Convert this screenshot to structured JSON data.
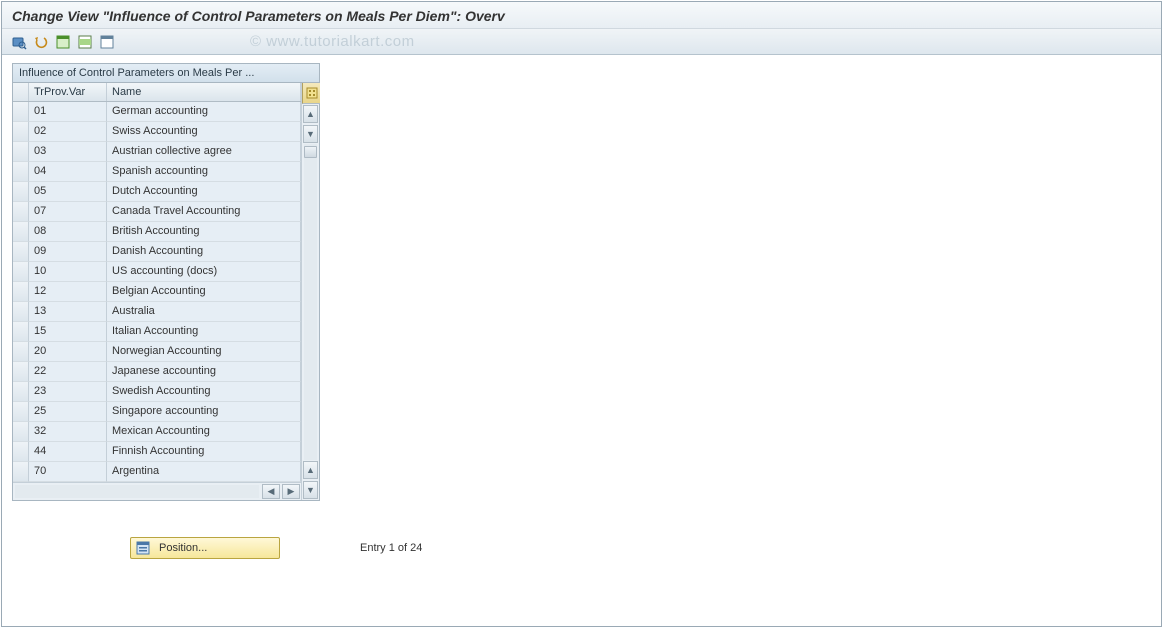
{
  "title": "Change View \"Influence of Control Parameters on Meals Per Diem\": Overv",
  "watermark": "© www.tutorialkart.com",
  "toolbar": {
    "icons": [
      "display-details-icon",
      "undo-icon",
      "select-all-icon",
      "select-block-icon",
      "deselect-all-icon"
    ]
  },
  "table": {
    "title": "Influence of Control Parameters on Meals Per ...",
    "columns": {
      "col1": "TrProv.Var",
      "col2": "Name"
    },
    "rows": [
      {
        "var": "01",
        "name": "German accounting"
      },
      {
        "var": "02",
        "name": "Swiss Accounting"
      },
      {
        "var": "03",
        "name": "Austrian collective agree"
      },
      {
        "var": "04",
        "name": "Spanish accounting"
      },
      {
        "var": "05",
        "name": "Dutch Accounting"
      },
      {
        "var": "07",
        "name": "Canada Travel Accounting"
      },
      {
        "var": "08",
        "name": "British Accounting"
      },
      {
        "var": "09",
        "name": "Danish Accounting"
      },
      {
        "var": "10",
        "name": "US accounting (docs)"
      },
      {
        "var": "12",
        "name": "Belgian Accounting"
      },
      {
        "var": "13",
        "name": "Australia"
      },
      {
        "var": "15",
        "name": "Italian Accounting"
      },
      {
        "var": "20",
        "name": "Norwegian Accounting"
      },
      {
        "var": "22",
        "name": "Japanese accounting"
      },
      {
        "var": "23",
        "name": "Swedish Accounting"
      },
      {
        "var": "25",
        "name": "Singapore accounting"
      },
      {
        "var": "32",
        "name": "Mexican Accounting"
      },
      {
        "var": "44",
        "name": "Finnish Accounting"
      },
      {
        "var": "70",
        "name": "Argentina"
      }
    ]
  },
  "footer": {
    "positionLabel": "Position...",
    "entryLabel": "Entry 1 of 24"
  }
}
